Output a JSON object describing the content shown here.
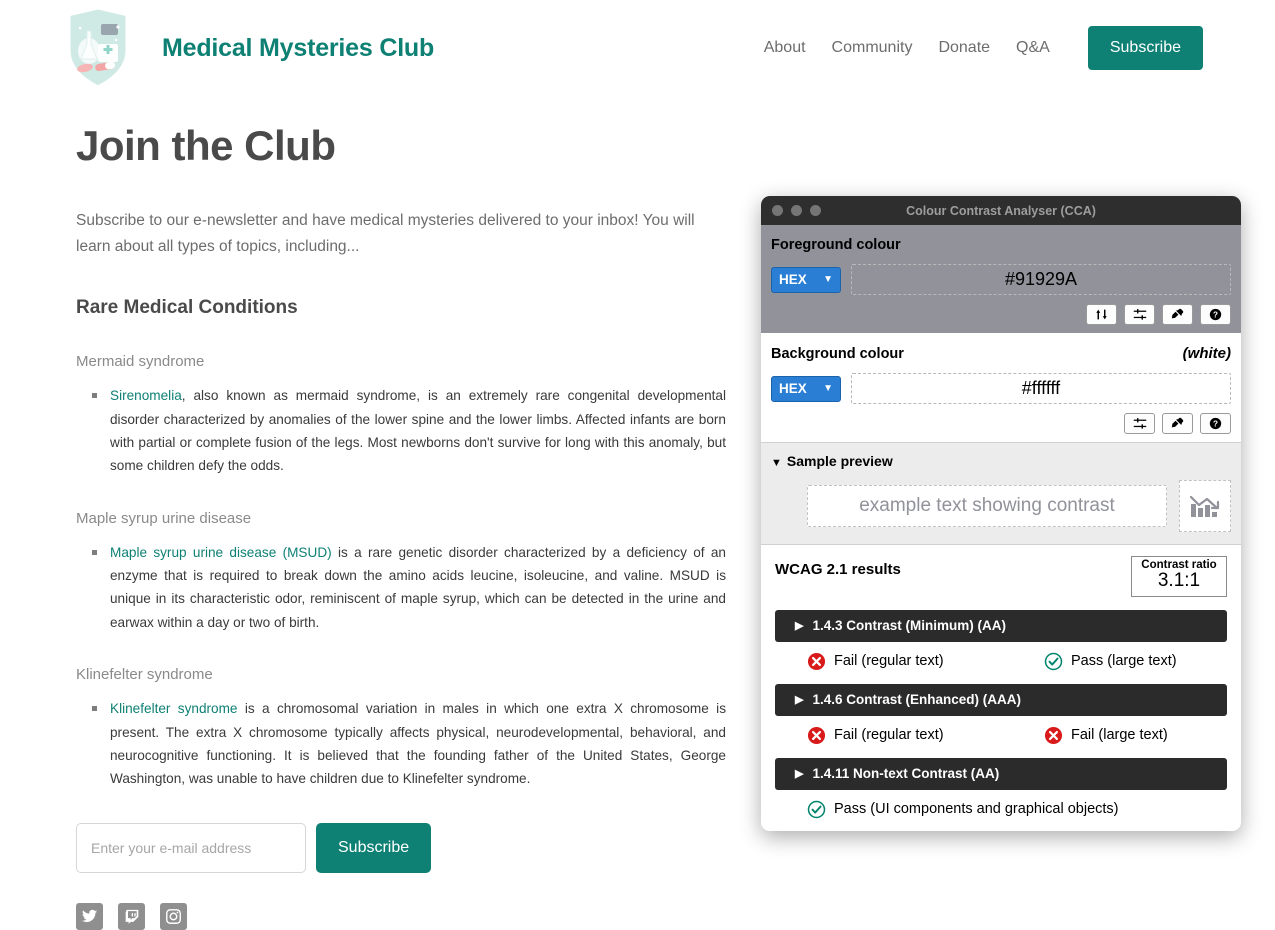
{
  "site": {
    "brand": "Medical Mysteries Club",
    "logo_icon": "medical-shield-logo",
    "nav": [
      {
        "label": "About"
      },
      {
        "label": "Community"
      },
      {
        "label": "Donate"
      },
      {
        "label": "Q&A"
      }
    ],
    "nav_cta": "Subscribe",
    "accent_color": "#0e8074"
  },
  "page": {
    "title": "Join the Club",
    "intro": "Subscribe to our e-newsletter and have medical mysteries delivered to your inbox! You will learn about all types of topics, including...",
    "section_title": "Rare Medical Conditions",
    "conditions": [
      {
        "heading": "Mermaid syndrome",
        "link_text": "Sirenomelia",
        "body": ", also known as mermaid syndrome, is an extremely rare congenital developmental disorder characterized by anomalies of the lower spine and the lower limbs. Affected infants are born with partial or complete fusion of the legs. Most newborns don't survive for long with this anomaly, but some children defy the odds."
      },
      {
        "heading": "Maple syrup urine disease",
        "link_text": "Maple syrup urine disease (MSUD)",
        "body": " is a rare genetic disorder characterized by a deficiency of an enzyme that is required to break down the amino acids leucine, isoleucine, and valine. MSUD is unique in its characteristic odor, reminiscent of maple syrup, which can be detected in the urine and earwax within a day or two of birth."
      },
      {
        "heading": "Klinefelter syndrome",
        "link_text": "Klinefelter syndrome",
        "body": " is a chromosomal variation in males in which one extra X chromosome is present. The extra X chromosome typically affects physical, neurodevelopmental, behavioral, and neurocognitive functioning. It is believed that the founding father of the United States, George Washington, was unable to have children due to Klinefelter syndrome."
      }
    ]
  },
  "subscribe_form": {
    "email_placeholder": "Enter your e-mail address",
    "email_value": "",
    "button_label": "Subscribe"
  },
  "socials": [
    {
      "name": "twitter-icon"
    },
    {
      "name": "twitch-icon"
    },
    {
      "name": "instagram-icon"
    }
  ],
  "cca": {
    "window_title": "Colour Contrast Analyser (CCA)",
    "foreground": {
      "label": "Foreground colour",
      "format": "HEX",
      "value": "#91929A",
      "buttons": [
        "swap-colours-icon",
        "sliders-icon",
        "eyedropper-icon",
        "help-icon"
      ]
    },
    "background": {
      "label": "Background colour",
      "note": "(white)",
      "format": "HEX",
      "value": "#ffffff",
      "buttons": [
        "sliders-icon",
        "eyedropper-icon",
        "help-icon"
      ]
    },
    "preview": {
      "header": "Sample preview",
      "sample_text": "example text showing contrast",
      "image_icon": "bar-chart-declining-icon"
    },
    "results": {
      "title": "WCAG 2.1 results",
      "ratio_label": "Contrast ratio",
      "ratio_value": "3.1:1",
      "criteria": [
        {
          "name": "1.4.3 Contrast (Minimum) (AA)",
          "results": [
            {
              "status": "fail",
              "text": "Fail (regular text)"
            },
            {
              "status": "pass",
              "text": "Pass (large text)"
            }
          ]
        },
        {
          "name": "1.4.6 Contrast (Enhanced) (AAA)",
          "results": [
            {
              "status": "fail",
              "text": "Fail (regular text)"
            },
            {
              "status": "fail",
              "text": "Fail (large text)"
            }
          ]
        },
        {
          "name": "1.4.11 Non-text Contrast (AA)",
          "results": [
            {
              "status": "pass",
              "text": "Pass (UI components and graphical objects)"
            }
          ]
        }
      ]
    }
  }
}
